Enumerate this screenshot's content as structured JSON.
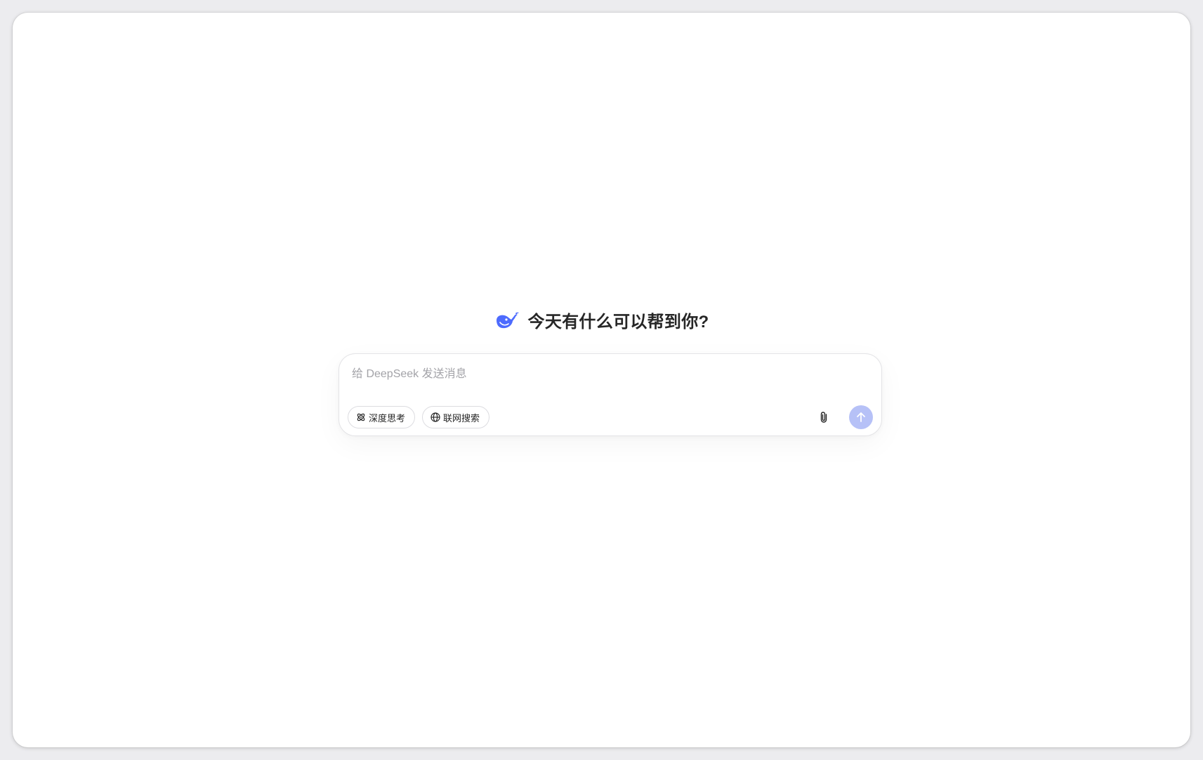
{
  "hero": {
    "logo_icon": "deepseek-whale-icon",
    "greeting": "今天有什么可以帮到你?"
  },
  "composer": {
    "placeholder": "给 DeepSeek 发送消息",
    "value": "",
    "chips": [
      {
        "label": "深度思考",
        "icon": "deep-think-icon"
      },
      {
        "label": "联网搜索",
        "icon": "globe-icon"
      }
    ],
    "attach_icon": "paperclip-icon",
    "send_icon": "arrow-up-icon"
  },
  "colors": {
    "brand": "#4d6bfe",
    "send_disabled": "#b6c1f7",
    "text": "#262626",
    "placeholder": "#a3a3a8"
  }
}
